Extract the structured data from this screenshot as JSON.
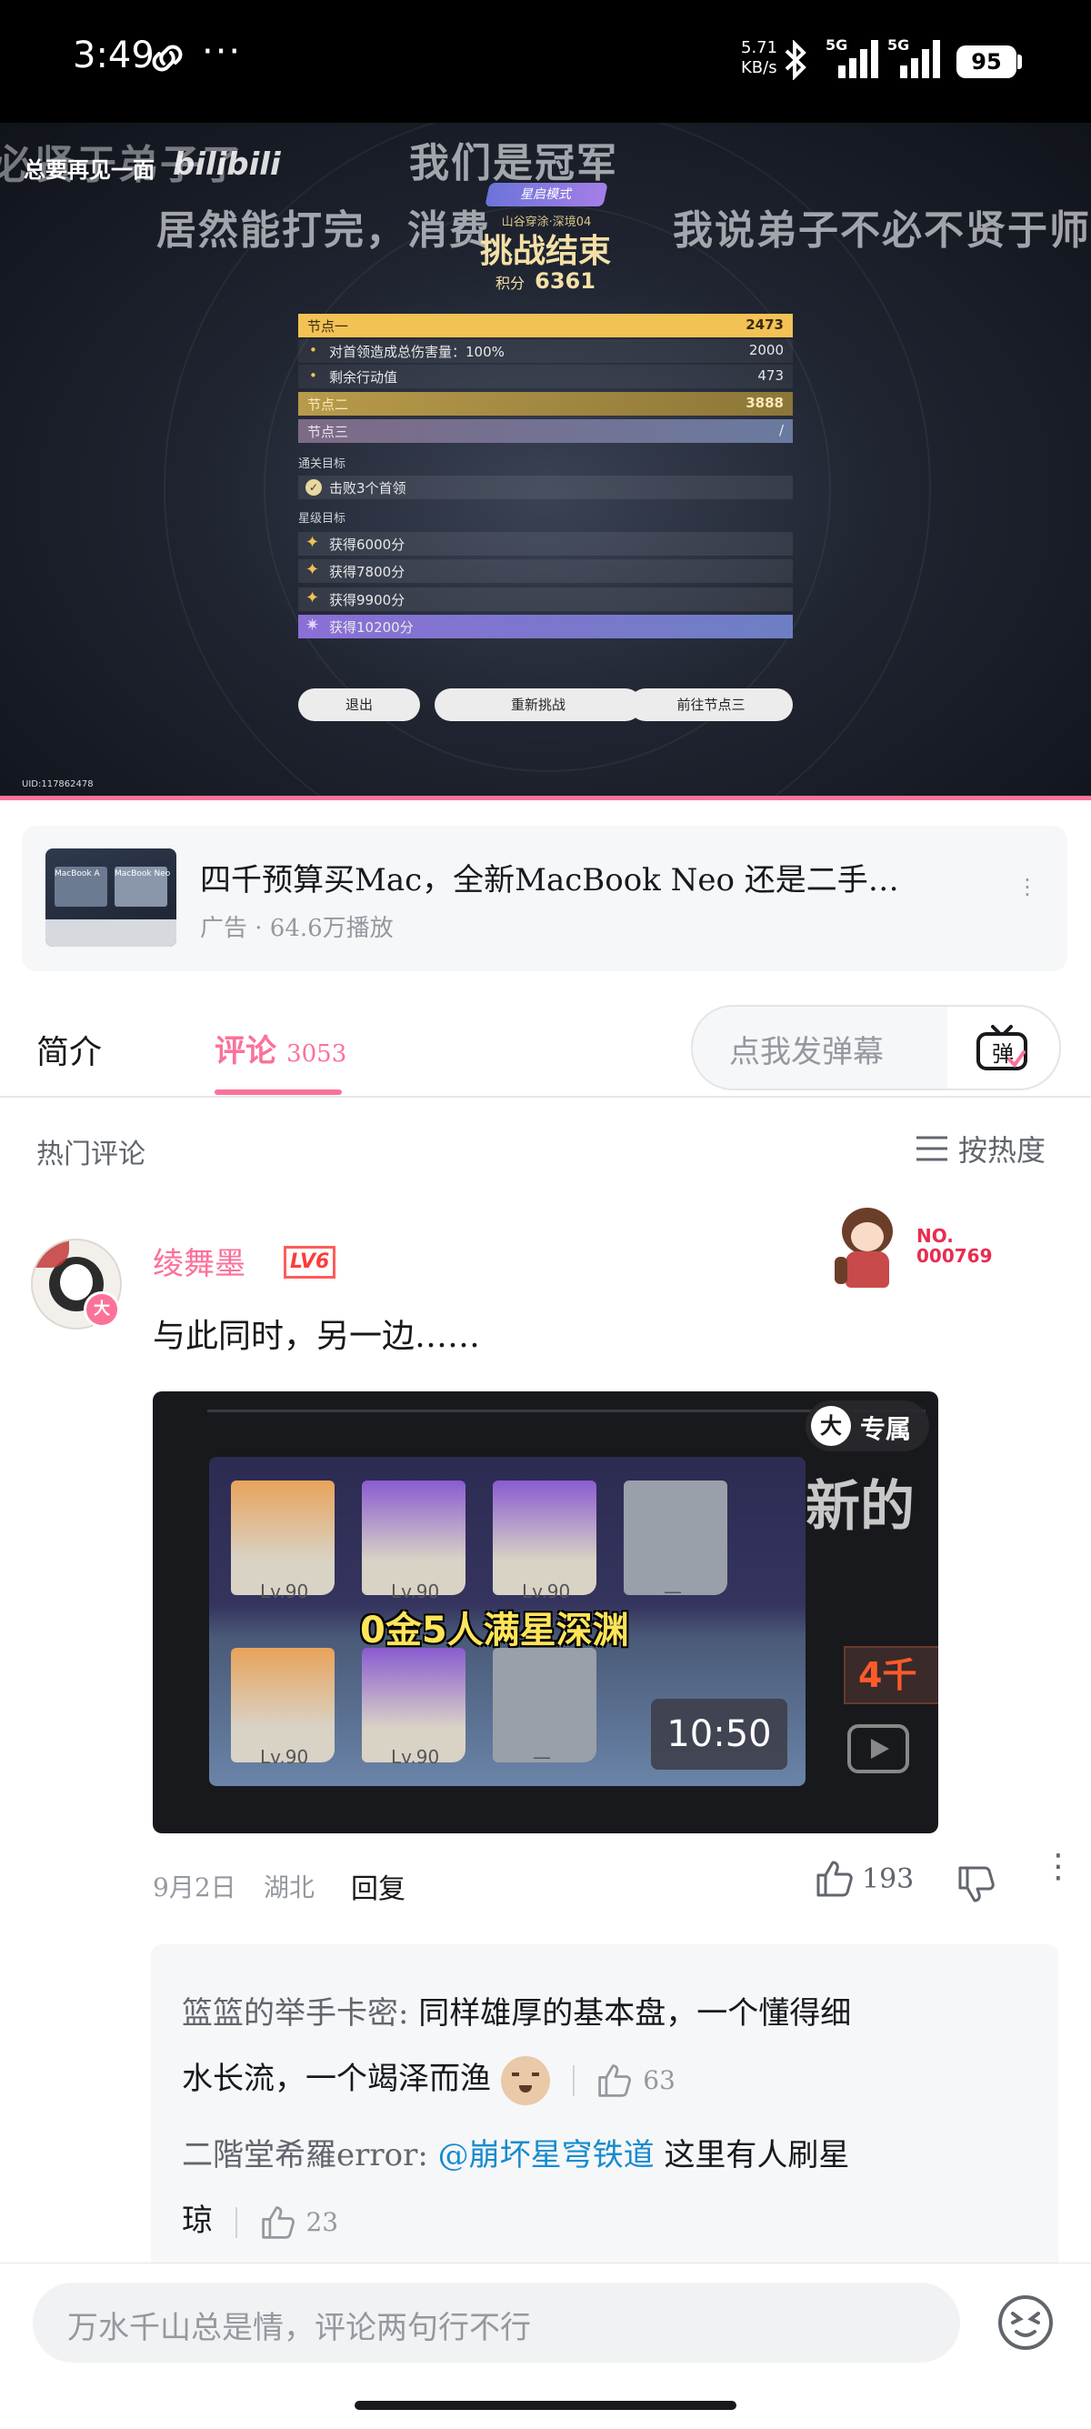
{
  "status_bar": {
    "time": "3:49",
    "net_speed_top": "5.71",
    "net_speed_bottom": "KB/s",
    "sig1_label": "5G",
    "sig2_label": "5G",
    "battery": "95"
  },
  "player": {
    "danmaku": [
      "总要再见一面",
      "必贤于弟子了",
      "我们是冠军",
      "居然能打完，消费",
      "我说弟子不必不贤于师"
    ],
    "watermark": "bilibili",
    "mode_badge": "星启模式",
    "stage_sub": "山谷穿涂·深境04",
    "result_title": "挑战结束",
    "score_label": "积分",
    "score_value": "6361",
    "rows": [
      {
        "label": "节点一",
        "value": "2473"
      },
      {
        "label": "对首领造成总伤害量：100%",
        "value": "2000"
      },
      {
        "label": "剩余行动值",
        "value": "473"
      },
      {
        "label": "节点二",
        "value": "3888"
      },
      {
        "label": "节点三",
        "value": "/"
      }
    ],
    "clear_goal_title": "通关目标",
    "clear_goal": "击败3个首领",
    "star_goal_title": "星级目标",
    "star_goals": [
      "获得6000分",
      "获得7800分",
      "获得9900分",
      "获得10200分"
    ],
    "buttons": [
      "退出",
      "重新挑战",
      "前往节点三"
    ],
    "uid": "UID:117862478"
  },
  "ad": {
    "title": "四千预算买Mac，全新MacBook Neo 还是二手…",
    "meta": "广告 · 64.6万播放",
    "thumb_label_left": "MacBook A",
    "thumb_label_right": "MacBook Neo"
  },
  "tabs": {
    "intro": "简介",
    "comments": "评论",
    "comments_count": "3053",
    "danmu_placeholder": "点我发弹幕",
    "danmu_icon_text": "弹"
  },
  "sort": {
    "hot_label": "热门评论",
    "sort_label": "按热度"
  },
  "comment": {
    "username": "绫舞墨",
    "level": "LV6",
    "badge_avatar_mark": "大",
    "fan_no_top": "NO.",
    "fan_no": "000769",
    "text": "与此同时，另一边……",
    "video": {
      "badge": "专属",
      "badge_mark": "大",
      "title": "0金5人满星深渊",
      "duration": "10:50",
      "side_text": "新的",
      "side_text2": "4千",
      "levels": [
        "Lv.90",
        "Lv.90",
        "Lv.90",
        "Lv.90",
        "Lv.90"
      ],
      "dash": "—"
    },
    "date": "9月2日",
    "location": "湖北",
    "reply": "回复",
    "likes": "193"
  },
  "replies": [
    {
      "user": "篮篮的举手卡密:",
      "text_line1": "同样雄厚的基本盘，一个懂得细",
      "text_line2": "水长流，一个竭泽而渔",
      "likes": "63"
    },
    {
      "user": "二階堂希羅error:",
      "mention": "@崩坏星穹铁道",
      "text_line1": "这里有人刷星",
      "text_line2": "琼",
      "likes": "23"
    }
  ],
  "input": {
    "placeholder": "万水千山总是情，评论两句行不行"
  },
  "colors": {
    "pink": "#fb7299",
    "link": "#178bcf",
    "gold_row": "#f2c255",
    "purple_row": "#8b6fd6"
  }
}
